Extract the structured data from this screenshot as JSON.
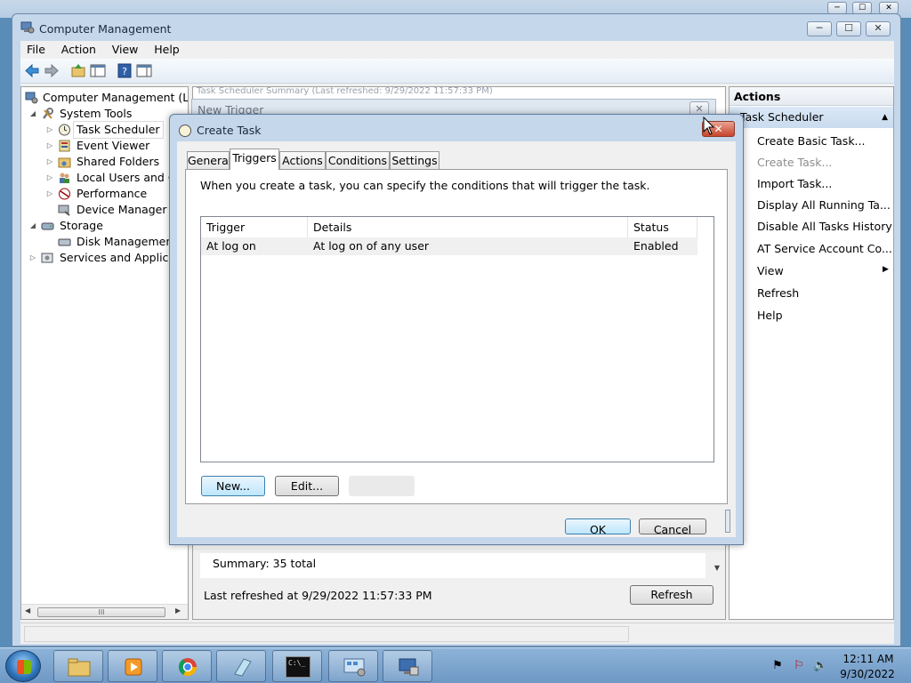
{
  "window": {
    "title": "Computer Management",
    "minimize": "─",
    "maximize": "☐",
    "close": "✕"
  },
  "menu": [
    "File",
    "Action",
    "View",
    "Help"
  ],
  "tree": {
    "root": "Computer Management (Local",
    "system_tools": "System Tools",
    "task_scheduler": "Task Scheduler",
    "event_viewer": "Event Viewer",
    "shared_folders": "Shared Folders",
    "local_users": "Local Users and Gro",
    "performance": "Performance",
    "device_manager": "Device Manager",
    "storage": "Storage",
    "disk_management": "Disk Management",
    "services": "Services and Application",
    "scroll_grip": "III"
  },
  "center": {
    "path_text": "Task Scheduler Summary (Last refreshed: 9/29/2022 11:57:33 PM)",
    "summary": "Summary: 35 total",
    "last_refreshed": "Last refreshed at 9/29/2022 11:57:33 PM",
    "refresh_button": "Refresh"
  },
  "actions": {
    "header": "Actions",
    "group": "Task Scheduler",
    "items": [
      {
        "label": "Create Basic Task...",
        "enabled": true
      },
      {
        "label": "Create Task...",
        "enabled": false
      },
      {
        "label": "Import Task...",
        "enabled": true
      },
      {
        "label": "Display All Running Ta...",
        "enabled": true
      },
      {
        "label": "Disable All Tasks History",
        "enabled": true
      },
      {
        "label": "AT Service Account Co...",
        "enabled": true
      },
      {
        "label": "View",
        "enabled": true
      },
      {
        "label": "Refresh",
        "enabled": true
      },
      {
        "label": "Help",
        "enabled": true
      }
    ]
  },
  "new_trigger": {
    "title": "New Trigger",
    "close": "✕"
  },
  "dialog": {
    "title": "Create Task",
    "close": "✕",
    "tabs": [
      "General",
      "Triggers",
      "Actions",
      "Conditions",
      "Settings"
    ],
    "active_tab": "Triggers",
    "intro": "When you create a task, you can specify the conditions that will trigger the task.",
    "columns": [
      "Trigger",
      "Details",
      "Status"
    ],
    "rows": [
      {
        "trigger": "At log on",
        "details": "At log on of any user",
        "status": "Enabled"
      }
    ],
    "new_button": "New...",
    "edit_button": "Edit...",
    "ok_button": "OK",
    "cancel_button": "Cancel"
  },
  "taskbar": {
    "time": "12:11 AM",
    "date": "9/30/2022",
    "cmd_label": "C:\\_"
  },
  "colors": {
    "accent": "#3c7fb1",
    "dialog_frame": "#c5d7eb",
    "close_red": "#c7452a"
  }
}
